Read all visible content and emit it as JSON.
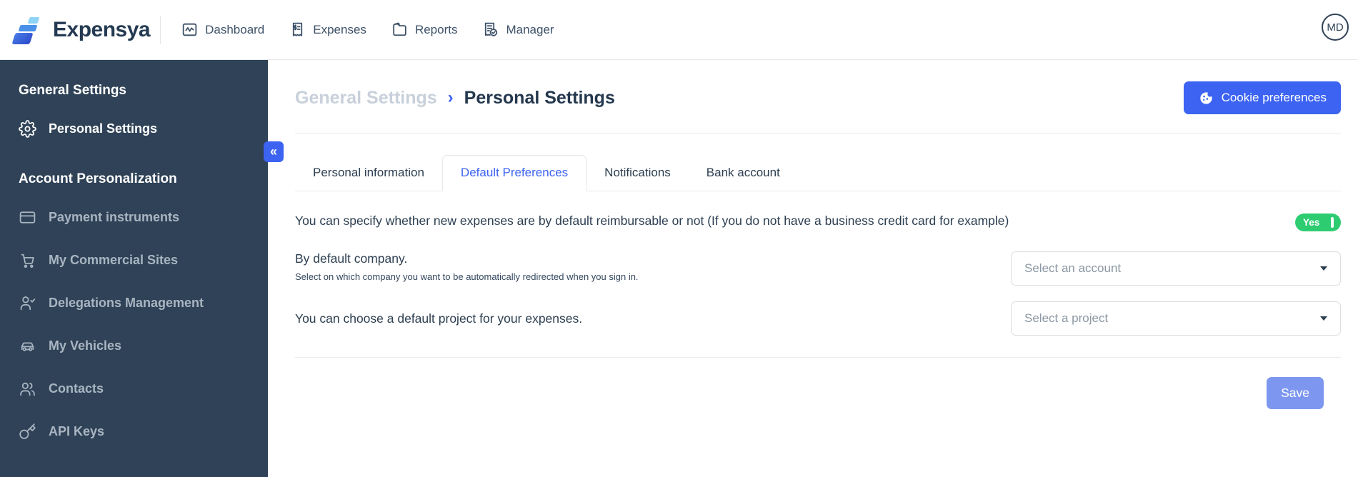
{
  "brand": {
    "name": "Expensya"
  },
  "navbar": {
    "items": [
      {
        "label": "Dashboard",
        "icon": "dashboard-icon"
      },
      {
        "label": "Expenses",
        "icon": "receipt-icon"
      },
      {
        "label": "Reports",
        "icon": "folder-icon"
      },
      {
        "label": "Manager",
        "icon": "receipt-check-icon"
      }
    ],
    "avatar_initials": "MD"
  },
  "sidebar": {
    "sections": [
      {
        "title": "General Settings",
        "items": [
          {
            "label": "Personal Settings",
            "icon": "gear-icon",
            "active": true
          }
        ]
      },
      {
        "title": "Account Personalization",
        "items": [
          {
            "label": "Payment instruments",
            "icon": "credit-card-icon",
            "active": false
          },
          {
            "label": "My Commercial Sites",
            "icon": "cart-icon",
            "active": false
          },
          {
            "label": "Delegations Management",
            "icon": "person-check-icon",
            "active": false
          },
          {
            "label": "My Vehicles",
            "icon": "car-icon",
            "active": false
          },
          {
            "label": "Contacts",
            "icon": "people-icon",
            "active": false
          },
          {
            "label": "API Keys",
            "icon": "key-icon",
            "active": false
          }
        ]
      }
    ]
  },
  "header": {
    "breadcrumb": {
      "parent": "General Settings",
      "separator": "›",
      "current": "Personal Settings"
    },
    "cookie_button_label": "Cookie preferences",
    "collapse_glyph": "«"
  },
  "tabs": [
    {
      "label": "Personal information",
      "active": false
    },
    {
      "label": "Default Preferences",
      "active": true
    },
    {
      "label": "Notifications",
      "active": false
    },
    {
      "label": "Bank account",
      "active": false
    }
  ],
  "content": {
    "reimbursable": {
      "text": "You can specify whether new expenses are by default reimbursable or not (If you do not have a business credit card for example)",
      "toggle_label": "Yes",
      "toggle_state": "on"
    },
    "company_row": {
      "label": "By default company.",
      "helper": "Select on which company you want to be automatically redirected when you sign in.",
      "select_value": "Select an account"
    },
    "project_row": {
      "label": "You can choose a default project for your expenses.",
      "select_value": "Select a project"
    },
    "save_label": "Save"
  },
  "colors": {
    "accent_blue": "#3c63f2",
    "sidebar_bg": "#2f4257",
    "toggle_green": "#2ecc71",
    "save_blue": "#7d97f0",
    "text_dark": "#2c3e50"
  }
}
